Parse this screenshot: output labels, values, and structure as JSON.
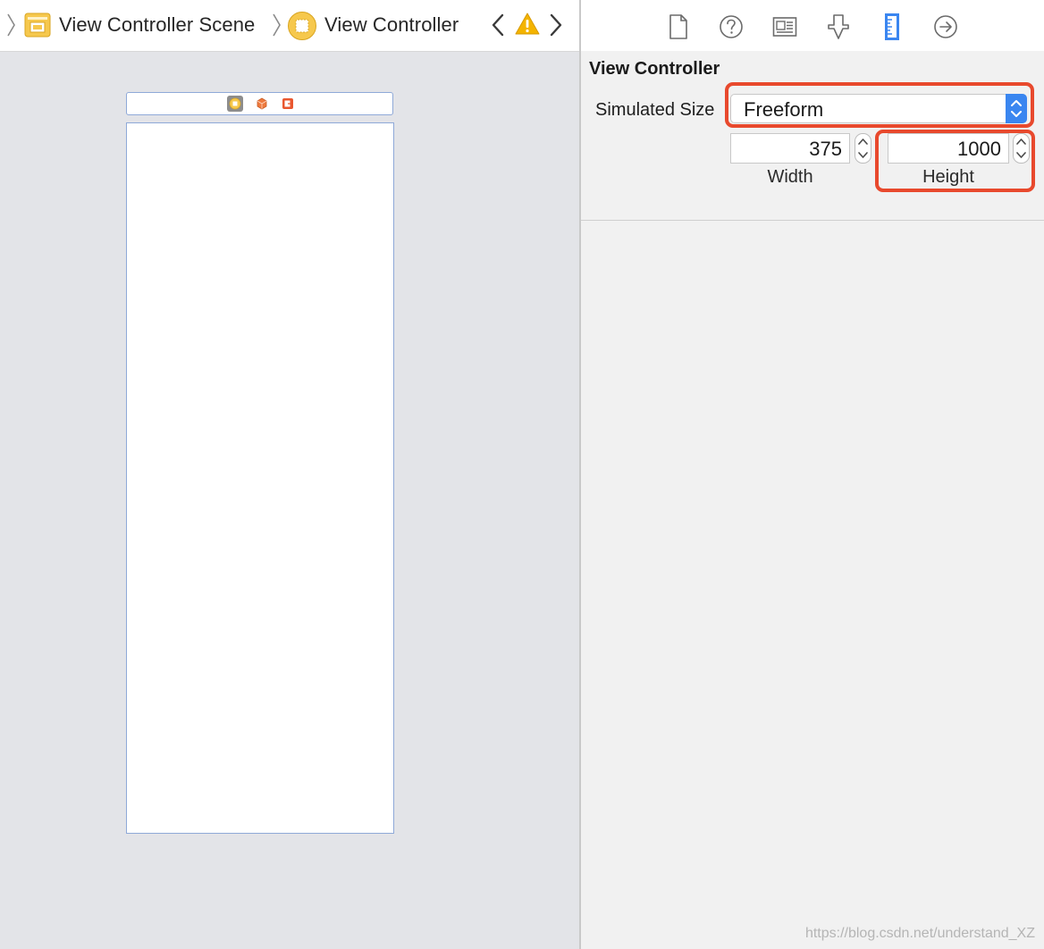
{
  "jumpbar": {
    "scene_label": "View Controller Scene",
    "controller_label": "View Controller"
  },
  "icons": {
    "breadcrumb_sep": "chevron-right-icon",
    "scene": "storyboard-scene-icon",
    "controller": "view-controller-icon",
    "back": "chevron-left-icon",
    "warning": "warning-icon",
    "forward": "chevron-right-icon",
    "inspector_tabs": [
      "file-inspector-icon",
      "quick-help-icon",
      "identity-inspector-icon",
      "attributes-inspector-icon",
      "size-inspector-icon",
      "connections-inspector-icon"
    ],
    "dock": [
      "view-controller-icon",
      "first-responder-icon",
      "exit-icon"
    ]
  },
  "inspector": {
    "section_title": "View Controller",
    "simulated_size_label": "Simulated Size",
    "simulated_size_value": "Freeform",
    "width_value": "375",
    "width_label": "Width",
    "height_value": "1000",
    "height_label": "Height",
    "selected_tab": "size-inspector-icon"
  },
  "watermark": "https://blog.csdn.net/understand_XZ",
  "colors": {
    "accent": "#3a86f0",
    "highlight": "#e8492d",
    "warning": "#f4b400",
    "canvas_bg": "#e3e4e8",
    "scene_border": "#8fa9d8"
  }
}
